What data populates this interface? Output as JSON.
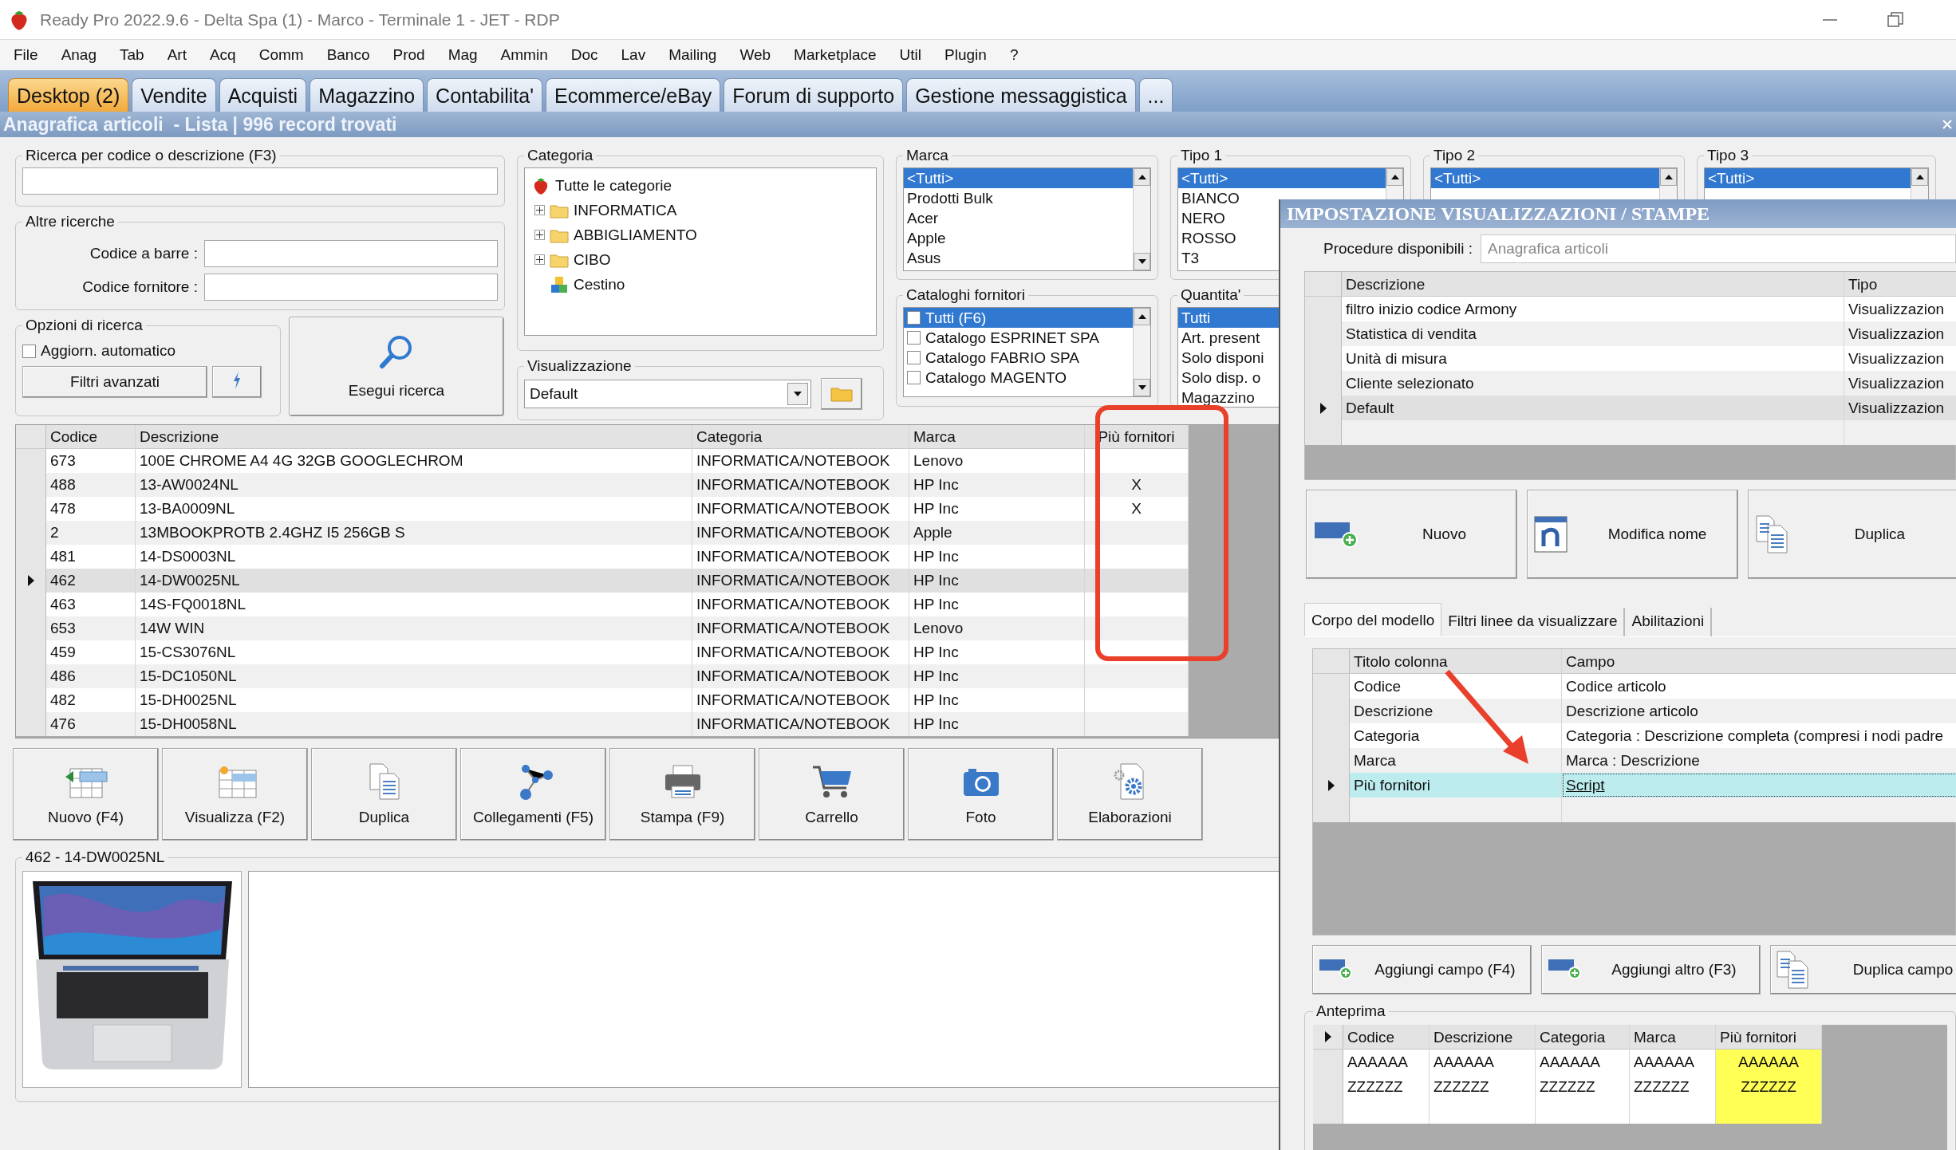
{
  "window": {
    "title": "Ready Pro 2022.9.6 - Delta Spa (1) - Marco - Terminale 1 - JET - RDP"
  },
  "menu": [
    "File",
    "Anag",
    "Tab",
    "Art",
    "Acq",
    "Comm",
    "Banco",
    "Prod",
    "Mag",
    "Ammin",
    "Doc",
    "Lav",
    "Mailing",
    "Web",
    "Marketplace",
    "Util",
    "Plugin",
    "?"
  ],
  "tabs": [
    {
      "label": "Desktop (2)",
      "selected": true
    },
    {
      "label": "Vendite",
      "selected": false
    },
    {
      "label": "Acquisti",
      "selected": false
    },
    {
      "label": "Magazzino",
      "selected": false
    },
    {
      "label": "Contabilita'",
      "selected": false
    },
    {
      "label": "Ecommerce/eBay",
      "selected": false
    },
    {
      "label": "Forum di supporto",
      "selected": false
    },
    {
      "label": "Gestione messaggistica",
      "selected": false
    },
    {
      "label": "...",
      "selected": false
    }
  ],
  "header": {
    "title": "Anagrafica articoli  - Lista | 996 record trovati"
  },
  "search": {
    "label": "Ricerca per codice o descrizione (F3)"
  },
  "other_searches": {
    "title": "Altre ricerche",
    "fields": [
      {
        "label": "Codice a barre :"
      },
      {
        "label": "Codice fornitore :"
      }
    ]
  },
  "search_options": {
    "title": "Opzioni di ricerca",
    "auto_update": {
      "label": "Aggiorn. automatico",
      "checked": false
    },
    "advanced_filters": "Filtri avanzati"
  },
  "search_button": "Esegui ricerca",
  "category": {
    "title": "Categoria",
    "tree": [
      {
        "label": "Tutte le categorie",
        "kind": "root",
        "children": [
          {
            "label": "INFORMATICA",
            "kind": "folder",
            "expanded": false
          },
          {
            "label": "ABBIGLIAMENTO",
            "kind": "folder",
            "expanded": false
          },
          {
            "label": "CIBO",
            "kind": "folder",
            "expanded": false
          },
          {
            "label": "Cestino",
            "kind": "trash"
          }
        ]
      }
    ]
  },
  "view": {
    "title": "Visualizzazione",
    "value": "Default"
  },
  "brand": {
    "title": "Marca",
    "items": [
      {
        "label": "<Tutti>",
        "selected": true
      },
      {
        "label": "Prodotti Bulk",
        "selected": false
      },
      {
        "label": "Acer",
        "selected": false
      },
      {
        "label": "Apple",
        "selected": false
      },
      {
        "label": "Asus",
        "selected": false
      }
    ]
  },
  "supplier_catalogs": {
    "title": "Cataloghi fornitori",
    "items": [
      {
        "label": "Tutti (F6)",
        "selected": true,
        "checked": false
      },
      {
        "label": "Catalogo ESPRINET SPA",
        "selected": false,
        "checked": false
      },
      {
        "label": "Catalogo FABRIO SPA",
        "selected": false,
        "checked": false
      },
      {
        "label": "Catalogo MAGENTO",
        "selected": false,
        "checked": false
      }
    ]
  },
  "type1": {
    "title": "Tipo 1",
    "items": [
      {
        "label": "<Tutti>",
        "selected": true
      },
      {
        "label": "BIANCO",
        "selected": false
      },
      {
        "label": "NERO",
        "selected": false
      },
      {
        "label": "ROSSO",
        "selected": false
      },
      {
        "label": "T3",
        "selected": false
      }
    ]
  },
  "quantity": {
    "title": "Quantita'",
    "items": [
      {
        "label": "Tutti",
        "selected": true
      },
      {
        "label": "Art. present",
        "selected": false
      },
      {
        "label": "Solo disponi",
        "selected": false
      },
      {
        "label": "Solo disp. o",
        "selected": false
      },
      {
        "label": "Magazzino",
        "selected": false
      }
    ]
  },
  "type2": {
    "title": "Tipo 2",
    "items": [
      {
        "label": "<Tutti>",
        "selected": true
      }
    ]
  },
  "type3": {
    "title": "Tipo 3",
    "items": [
      {
        "label": "<Tutti>",
        "selected": true
      }
    ]
  },
  "table": {
    "columns": [
      "Codice",
      "Descrizione",
      "Categoria",
      "Marca",
      "Più fornitori"
    ],
    "rows": [
      {
        "cells": [
          "673",
          "100E CHROME A4 4G 32GB GOOGLECHROM",
          "INFORMATICA/NOTEBOOK",
          "Lenovo"
        ],
        "selected": false
      },
      {
        "cells": [
          "488",
          "13-AW0024NL",
          "INFORMATICA/NOTEBOOK",
          "HP Inc"
        ],
        "piu_fornitori": "X",
        "selected": false
      },
      {
        "cells": [
          "478",
          "13-BA0009NL",
          "INFORMATICA/NOTEBOOK",
          "HP Inc"
        ],
        "piu_fornitori": "X",
        "selected": false
      },
      {
        "cells": [
          "2",
          "13MBOOKPROTB 2.4GHZ I5 256GB S",
          "INFORMATICA/NOTEBOOK",
          "Apple"
        ],
        "selected": false
      },
      {
        "cells": [
          "481",
          "14-DS0003NL",
          "INFORMATICA/NOTEBOOK",
          "HP Inc"
        ],
        "selected": false
      },
      {
        "cells": [
          "462",
          "14-DW0025NL",
          "INFORMATICA/NOTEBOOK",
          "HP Inc"
        ],
        "selected": true
      },
      {
        "cells": [
          "463",
          "14S-FQ0018NL",
          "INFORMATICA/NOTEBOOK",
          "HP Inc"
        ],
        "selected": false
      },
      {
        "cells": [
          "653",
          "14W WIN",
          "INFORMATICA/NOTEBOOK",
          "Lenovo"
        ],
        "selected": false
      },
      {
        "cells": [
          "459",
          "15-CS3076NL",
          "INFORMATICA/NOTEBOOK",
          "HP Inc"
        ],
        "selected": false
      },
      {
        "cells": [
          "486",
          "15-DC1050NL",
          "INFORMATICA/NOTEBOOK",
          "HP Inc"
        ],
        "selected": false
      },
      {
        "cells": [
          "482",
          "15-DH0025NL",
          "INFORMATICA/NOTEBOOK",
          "HP Inc"
        ],
        "selected": false
      },
      {
        "cells": [
          "476",
          "15-DH0058NL",
          "INFORMATICA/NOTEBOOK",
          "HP Inc"
        ],
        "selected": false
      }
    ]
  },
  "toolbar": [
    {
      "label": "Nuovo (F4)",
      "kind": "new"
    },
    {
      "label": "Visualizza (F2)",
      "kind": "view"
    },
    {
      "label": "Duplica",
      "kind": "duplicate"
    },
    {
      "label": "Collegamenti (F5)",
      "kind": "links"
    },
    {
      "label": "Stampa (F9)",
      "kind": "print"
    },
    {
      "label": "Carrello",
      "kind": "cart"
    },
    {
      "label": "Foto"
    },
    {
      "label": "Elaborazioni",
      "kind": "process"
    }
  ],
  "detail": {
    "title": "462 - 14-DW0025NL"
  },
  "dialog": {
    "title": "IMPOSTAZIONE VISUALIZZAZIONI / STAMPE",
    "procedure": {
      "label": "Procedure disponibili :",
      "value": "Anagrafica articoli"
    },
    "models": {
      "columns": [
        "Descrizione",
        "Tipo"
      ],
      "rows": [
        {
          "cells": [
            "filtro inizio codice Armony",
            "Visualizzazion"
          ],
          "selected": false
        },
        {
          "cells": [
            "Statistica di vendita",
            "Visualizzazion"
          ],
          "selected": false
        },
        {
          "cells": [
            "Unità di misura",
            "Visualizzazion"
          ],
          "selected": false
        },
        {
          "cells": [
            "Cliente selezionato",
            "Visualizzazion"
          ],
          "selected": false
        },
        {
          "cells": [
            "Default",
            "Visualizzazion"
          ],
          "selected": true
        }
      ]
    },
    "buttons": [
      {
        "label": "Nuovo",
        "kind": "new"
      },
      {
        "label": "Modifica nome",
        "kind": "rename"
      },
      {
        "label": "Duplica",
        "kind": "duplicate"
      }
    ],
    "tabs": [
      {
        "label": "Corpo del modello",
        "selected": true
      },
      {
        "label": "Filtri linee da visualizzare",
        "selected": false
      },
      {
        "label": "Abilitazioni",
        "selected": false
      }
    ],
    "fields": {
      "columns": [
        "Titolo colonna",
        "Campo"
      ],
      "rows": [
        {
          "cells": [
            "Codice",
            "Codice articolo"
          ],
          "selected": false
        },
        {
          "cells": [
            "Descrizione",
            "Descrizione articolo"
          ],
          "selected": false
        },
        {
          "cells": [
            "Categoria",
            "Categoria : Descrizione completa (compresi i nodi padre"
          ],
          "selected": false
        },
        {
          "cells": [
            "Marca",
            "Marca : Descrizione"
          ],
          "selected": false
        },
        {
          "cells": [
            "Più fornitori",
            "Script"
          ],
          "selected": true
        }
      ]
    },
    "field_buttons": [
      {
        "label": "Aggiungi campo (F4)",
        "kind": "add"
      },
      {
        "label": "Aggiungi altro (F3)",
        "kind": "add"
      },
      {
        "label": "Duplica campo",
        "kind": "duplicate"
      }
    ],
    "preview": {
      "title": "Anteprima",
      "columns": [
        {
          "label": "Codice",
          "highlighted": false
        },
        {
          "label": "Descrizione",
          "highlighted": false
        },
        {
          "label": "Categoria",
          "highlighted": false
        },
        {
          "label": "Marca",
          "highlighted": false
        },
        {
          "label": "Più fornitori",
          "highlighted": true
        }
      ],
      "rows": [
        {
          "cells": [
            "AAAAAA",
            "AAAAAA",
            "AAAAAA",
            "AAAAAA",
            "AAAAAA"
          ]
        },
        {
          "cells": [
            "ZZZZZZ",
            "ZZZZZZ",
            "ZZZZZZ",
            "ZZZZZZ",
            "ZZZZZZ"
          ]
        }
      ]
    }
  }
}
